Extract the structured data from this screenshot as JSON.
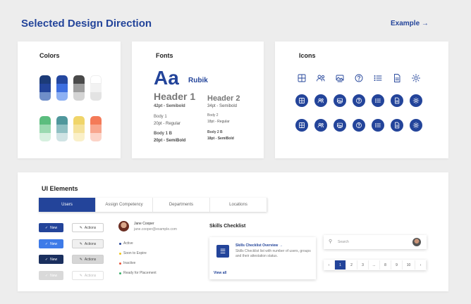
{
  "header": {
    "title": "Selected Design Direction",
    "example_link": "Example"
  },
  "colors": {
    "title": "Colors",
    "palette_top": [
      [
        "#1c3b78",
        "#23449a",
        "#6f8ec9"
      ],
      [
        "#24479f",
        "#3e6fe0",
        "#8db0f3"
      ],
      [
        "#4a4a4a",
        "#9e9e9e",
        "#d4d4d4"
      ],
      [
        "#ffffff",
        "#f2f2f2",
        "#e3e3e3"
      ]
    ],
    "palette_bottom": [
      [
        "#5bbd7e",
        "#9ad9b0",
        "#d6f0df"
      ],
      [
        "#4f979c",
        "#8fc0c3",
        "#cfe3e4"
      ],
      [
        "#f0d56a",
        "#f5e29b",
        "#faf0c9"
      ],
      [
        "#f47a58",
        "#f8a68e",
        "#fcd3c7"
      ]
    ]
  },
  "fonts": {
    "title": "Fonts",
    "sample": "Aa",
    "family": "Rubik",
    "header1": "Header 1",
    "header1_spec": "42pt - Semibold",
    "header2": "Header 2",
    "header2_spec": "34pt - Semibold",
    "body1": "Body 1",
    "body1_spec": "20pt - Regular",
    "body2": "Body 2",
    "body2_spec": "18pt - Regular",
    "body1b": "Body 1 B",
    "body1b_spec": "20pt - SemiBold",
    "body2b": "Body 2 B",
    "body2b_spec": "18pt - SemiBold"
  },
  "icons": {
    "title": "Icons",
    "set": [
      "grid-icon",
      "users-icon",
      "image-icon",
      "help-icon",
      "list-icon",
      "document-icon",
      "settings-icon"
    ],
    "accent": "#23449a"
  },
  "ui": {
    "title": "UI Elements",
    "tabs": [
      "Users",
      "Assign Competency",
      "Departments",
      "Locations"
    ],
    "new_label": "New",
    "actions_label": "Actions",
    "user": {
      "name": "Jane Cooper",
      "email": "jane.cooper@example.com"
    },
    "statuses": [
      {
        "label": "Active",
        "color": "#23449a"
      },
      {
        "label": "Soon to Expire",
        "color": "#f0c419"
      },
      {
        "label": "Inactive",
        "color": "#e8553b"
      },
      {
        "label": "Ready for Placement",
        "color": "#3aaf6a"
      }
    ],
    "skills": {
      "title": "Skills Checklist",
      "card_title": "Skills Checklist Overview",
      "card_desc": "Skills Checklist list with number of users, groups and their attestation status.",
      "view_all": "View all"
    },
    "search": {
      "placeholder": "Search"
    },
    "pagination": [
      "1",
      "2",
      "3",
      "...",
      "8",
      "9",
      "10"
    ]
  }
}
